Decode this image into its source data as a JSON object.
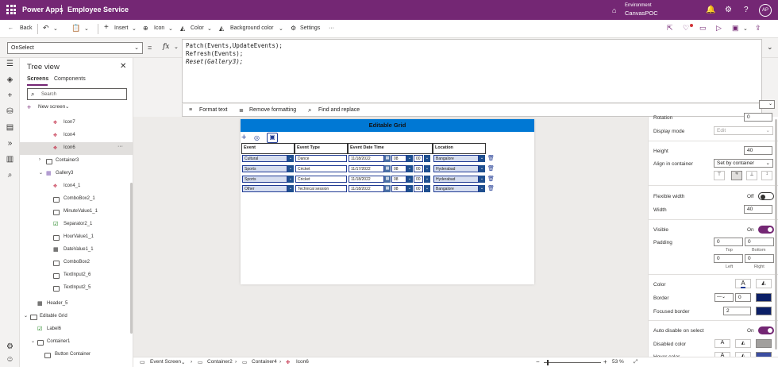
{
  "titlebar": {
    "app": "Power Apps",
    "app_name": "Employee Service",
    "env_label": "Environment",
    "env_value": "CanvasPOC",
    "avatar": "AP"
  },
  "cmdbar": {
    "back": "Back",
    "insert": "Insert",
    "icon": "Icon",
    "color": "Color",
    "bgcolor": "Background color",
    "settings": "Settings",
    "more": "···"
  },
  "formula": {
    "property": "OnSelect",
    "fx": "fx",
    "equals": "=",
    "lines": [
      "Patch(Events,UpdateEvents);",
      "Refresh(Events);",
      "Reset(Gallery3);"
    ],
    "format_text": "Format text",
    "remove_formatting": "Remove formatting",
    "find_replace": "Find and replace"
  },
  "tree": {
    "title": "Tree view",
    "tab_screens": "Screens",
    "tab_components": "Components",
    "search_placeholder": "Search",
    "new_screen": "New screen",
    "items": [
      {
        "label": "Icon7",
        "icon": "icon-group-icon"
      },
      {
        "label": "Icon4",
        "icon": "icon-group-icon"
      },
      {
        "label": "Icon6",
        "icon": "icon-group-icon"
      },
      {
        "label": "Container3",
        "icon": "container-icon"
      },
      {
        "label": "Gallery3",
        "icon": "gallery-icon"
      },
      {
        "label": "Icon4_1",
        "icon": "icon-group-icon"
      },
      {
        "label": "ComboBox2_1",
        "icon": "combobox-icon"
      },
      {
        "label": "MinuteValue1_1",
        "icon": "dropdown-icon"
      },
      {
        "label": "Separator2_1",
        "icon": "label-icon"
      },
      {
        "label": "HourValue1_1",
        "icon": "dropdown-icon"
      },
      {
        "label": "DateValue1_1",
        "icon": "date-icon"
      },
      {
        "label": "ComboBox2",
        "icon": "combobox-icon"
      },
      {
        "label": "TextInput2_6",
        "icon": "textinput-icon"
      },
      {
        "label": "TextInput2_5",
        "icon": "textinput-icon"
      },
      {
        "label": "Header_5",
        "icon": "header-icon"
      },
      {
        "label": "Editable Grid",
        "icon": "screen-icon"
      },
      {
        "label": "Label6",
        "icon": "label-icon"
      },
      {
        "label": "Container1",
        "icon": "container-icon"
      },
      {
        "label": "Button Container",
        "icon": "container-icon"
      }
    ]
  },
  "grid": {
    "title": "Editable Grid",
    "columns": [
      "Event",
      "Event Type",
      "Event Date Time",
      "Location"
    ],
    "rows": [
      {
        "event": "Cultural",
        "type": "Dance",
        "date": "11/18/2022",
        "hour": "08",
        "minute": "00",
        "location": "Bangalore"
      },
      {
        "event": "Sports",
        "type": "Cricket",
        "date": "11/17/2022",
        "hour": "08",
        "minute": "00",
        "location": "Hyderabad"
      },
      {
        "event": "Sports",
        "type": "Cricket",
        "date": "11/18/2022",
        "hour": "08",
        "minute": "00",
        "location": "Hyderabad"
      },
      {
        "event": "Other",
        "type": "Technical session",
        "date": "11/18/2022",
        "hour": "08",
        "minute": "00",
        "location": "Bangalore"
      }
    ]
  },
  "props": {
    "rotation_label": "Rotation",
    "rotation_value": "0",
    "display_mode_label": "Display mode",
    "display_mode_value": "Edit",
    "height_label": "Height",
    "height_value": "40",
    "align_label": "Align in container",
    "align_value": "Set by container",
    "flexible_width_label": "Flexible width",
    "flexible_width_state": "Off",
    "width_label": "Width",
    "width_value": "40",
    "visible_label": "Visible",
    "visible_state": "On",
    "padding_label": "Padding",
    "padding_top": "0",
    "padding_bottom": "0",
    "padding_left": "0",
    "padding_right": "0",
    "top": "Top",
    "bottom": "Bottom",
    "left": "Left",
    "right": "Right",
    "color_label": "Color",
    "border_label": "Border",
    "border_value": "0",
    "focused_border_label": "Focused border",
    "focused_border_value": "2",
    "auto_disable_label": "Auto disable on select",
    "auto_disable_state": "On",
    "disabled_color_label": "Disabled color",
    "hover_color_label": "Hover color"
  },
  "status": {
    "screen": "Event Screen",
    "crumb1": "Container2",
    "crumb2": "Container4",
    "crumb3": "Icon6",
    "zoom": "53 %"
  },
  "colors": {
    "brand": "#742774",
    "grid_header": "#0078d4",
    "toggle_on": "#742774"
  }
}
